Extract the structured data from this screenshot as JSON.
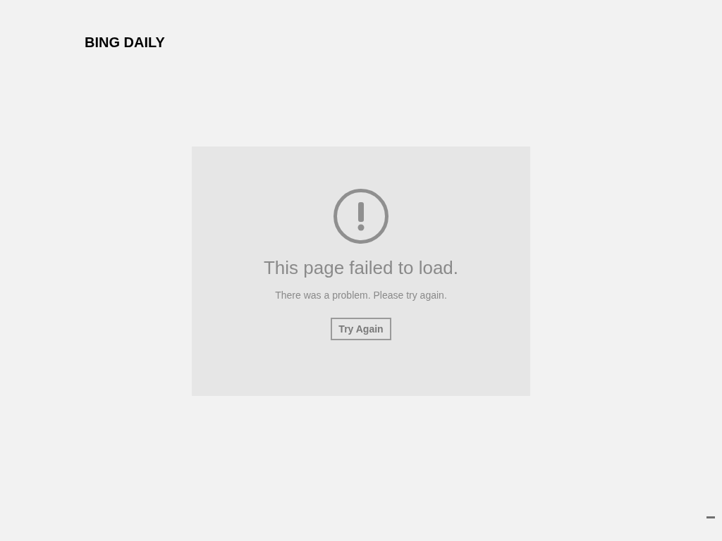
{
  "app_title": "BING DAILY",
  "error": {
    "heading": "This page failed to load.",
    "message": "There was a problem. Please try again.",
    "button": "Try Again"
  }
}
